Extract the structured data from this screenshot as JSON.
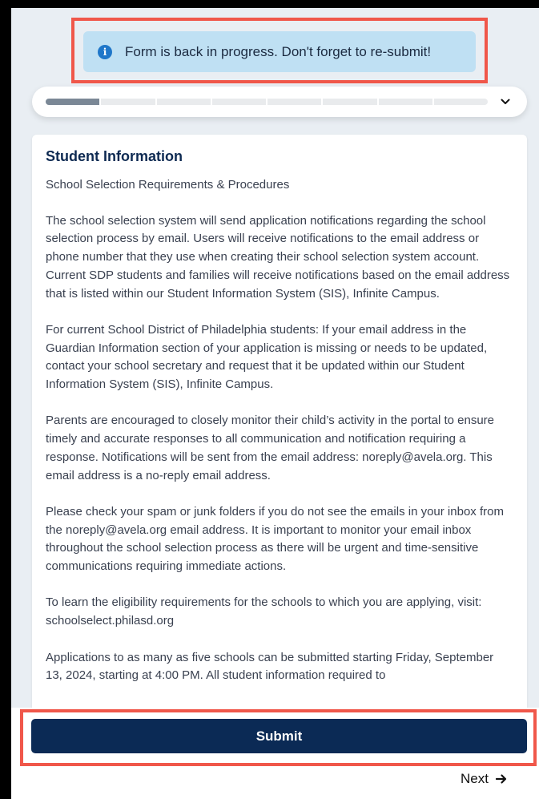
{
  "alert": {
    "icon": "info-icon",
    "text": "Form is back in progress. Don't forget to re-submit!"
  },
  "progress": {
    "segments": 8,
    "completed": 1,
    "toggle_icon": "chevron-down-icon"
  },
  "section": {
    "title": "Student Information",
    "subtitle": "School Selection Requirements & Procedures",
    "paragraphs": [
      "The school selection system will send application notifications regarding the school selection process by email. Users will receive notifications to the email address or phone number that they use when creating their school selection system account. Current SDP students and families will receive notifications based on the email address that is listed within our Student Information System (SIS), Infinite Campus.",
      "For current School District of Philadelphia students: If your email address in the Guardian Information section of your application is missing or needs to be updated, contact your school secretary and request that it be updated within our Student Information System (SIS), Infinite Campus.",
      "Parents are encouraged to closely monitor their child’s activity in the portal to ensure timely and accurate responses to all communication and notification requiring a response.  Notifications will be sent from the email address: noreply@avela.org.  This email address is a no-reply email address.",
      "Please check your spam or junk folders if you do not see the emails in your inbox from the noreply@avela.org email address. It is important to monitor your email inbox throughout the school selection process as there will be urgent and time-sensitive communications requiring immediate actions.",
      "To learn the eligibility requirements for the schools to which you are applying, visit: schoolselect.philasd.org",
      "Applications to as many as five schools can be submitted starting Friday, September 13, 2024, starting at 4:00 PM.  All student information required to"
    ]
  },
  "actions": {
    "submit_label": "Submit",
    "next_label": "Next",
    "next_icon": "arrow-right-icon"
  }
}
